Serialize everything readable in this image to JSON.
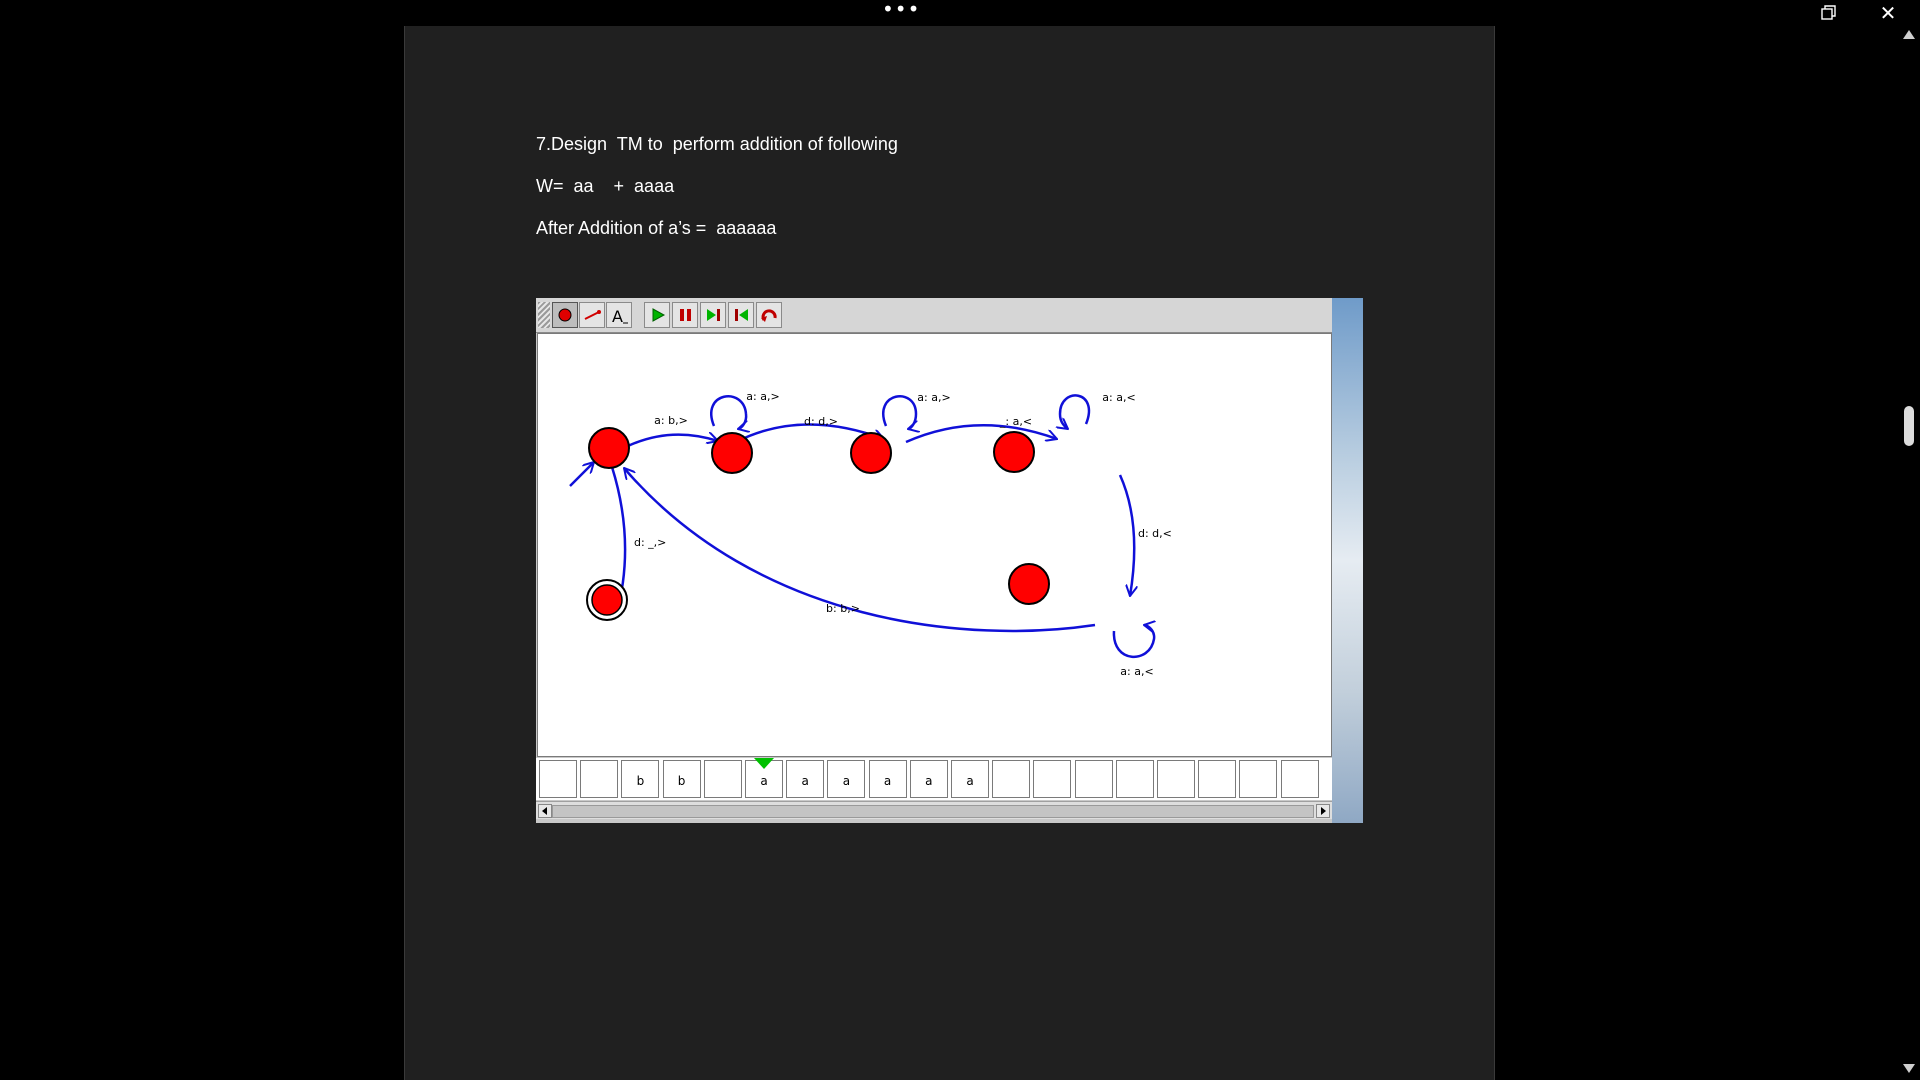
{
  "window": {
    "more_icon": "ellipsis-icon",
    "restore_icon": "restore-icon",
    "close_icon": "close-icon",
    "more_glyph": "•••",
    "close_glyph": "✕"
  },
  "document": {
    "line1": "7.Design  TM to  perform addition of following",
    "line2": "W=  aa    +  aaaa",
    "line3": "After Addition of a’s =  aaaaaa"
  },
  "jflap": {
    "tools": [
      "state-tool-icon",
      "transition-tool-icon",
      "label-tool-icon",
      "run-icon",
      "pause-icon",
      "step-forward-icon",
      "step-back-icon",
      "reset-icon"
    ],
    "transitions": {
      "q0_q1": "a: b,>",
      "q1_loop": "a: a,>",
      "q1_q2": "d: d,>",
      "q2_loop": "a: a,>",
      "q2_q3": "_: a,<",
      "q3_loop": "a: a,<",
      "q3_q4": "d: d,<",
      "q4_loop": "a: a,<",
      "q4_q0": "b: b,>",
      "q0_final": "d: _,>"
    },
    "tape": [
      "",
      "",
      "b",
      "b",
      "",
      "a",
      "a",
      "a",
      "a",
      "a",
      "a",
      "",
      "",
      "",
      "",
      "",
      "",
      "",
      ""
    ],
    "head_index": 5,
    "colors": {
      "state_fill": "#ff0000",
      "transition": "#1010d8",
      "head": "#00c000"
    }
  }
}
